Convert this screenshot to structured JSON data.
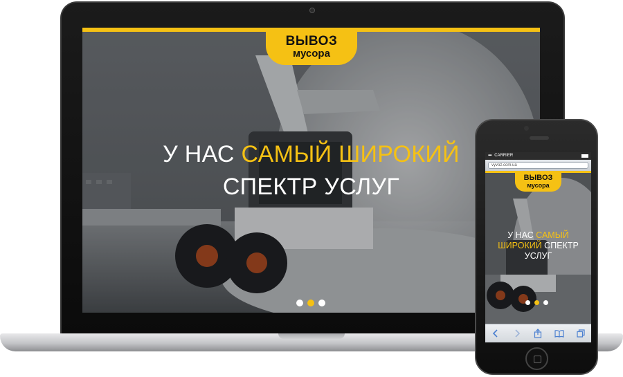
{
  "site": {
    "logo_line1": "ВЫВОЗ",
    "logo_line2": "мусора",
    "headline_part1": "У НАС ",
    "headline_accent": "САМЫЙ ШИРОКИЙ",
    "headline_part2": "СПЕКТР УСЛУГ",
    "slider": {
      "count": 3,
      "active_index": 1
    }
  },
  "phone": {
    "carrier": "CARRIER",
    "url": "vyvoz.com.ua",
    "headline_part1": "У НАС ",
    "headline_accent": "САМЫЙ ШИРОКИЙ",
    "headline_part2": " СПЕКТР УСЛУГ",
    "toolbar_icons": [
      "back-icon",
      "forward-icon",
      "share-icon",
      "bookmarks-icon",
      "tabs-icon"
    ]
  },
  "colors": {
    "brand_yellow": "#f5c114",
    "toolbar_icon_blue": "#4a7fd0"
  }
}
